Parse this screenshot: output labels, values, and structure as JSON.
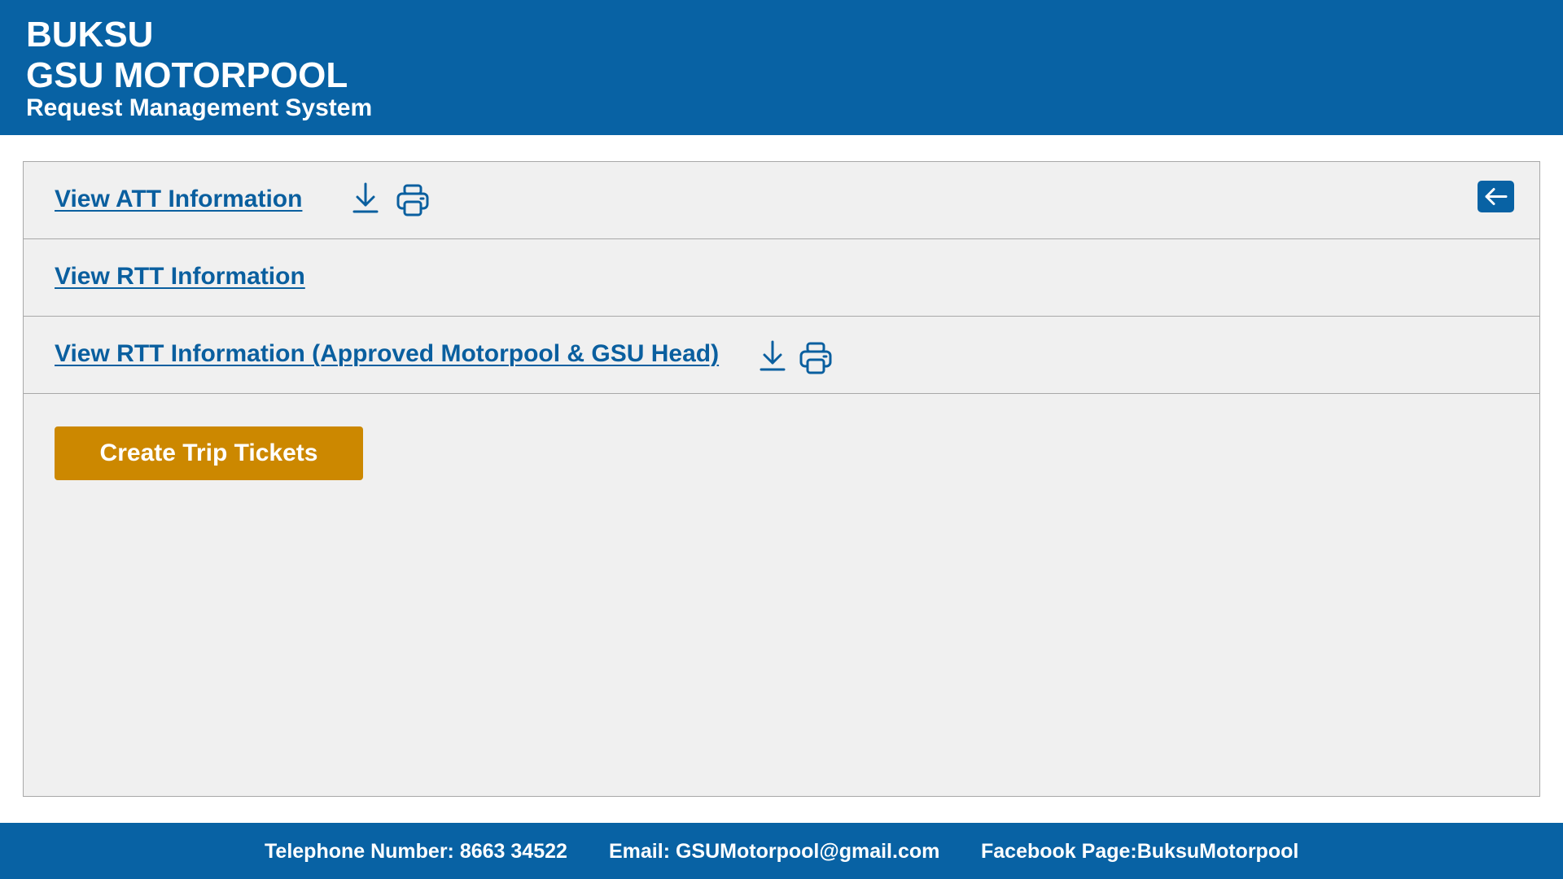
{
  "header": {
    "line1": "BUKSU",
    "line2": "GSU MOTORPOOL",
    "line3": "Request Management System"
  },
  "links": {
    "att": "View ATT Information",
    "rtt": "View RTT Information",
    "rtt_approved": "View RTT Information (Approved Motorpool & GSU Head)"
  },
  "icons": {
    "download": "download-icon",
    "print": "printer-icon",
    "back": "arrow-left-icon"
  },
  "buttons": {
    "create_trip_tickets": "Create Trip Tickets"
  },
  "footer": {
    "telephone": "Telephone Number: 8663 34522",
    "email": "Email: GSUMotorpool@gmail.com",
    "facebook": "Facebook Page:BuksuMotorpool"
  },
  "colors": {
    "brand_blue": "#0862a4",
    "link_blue": "#0a5f9f",
    "button_gold": "#cc8800",
    "panel_bg": "#f0f0f0"
  }
}
